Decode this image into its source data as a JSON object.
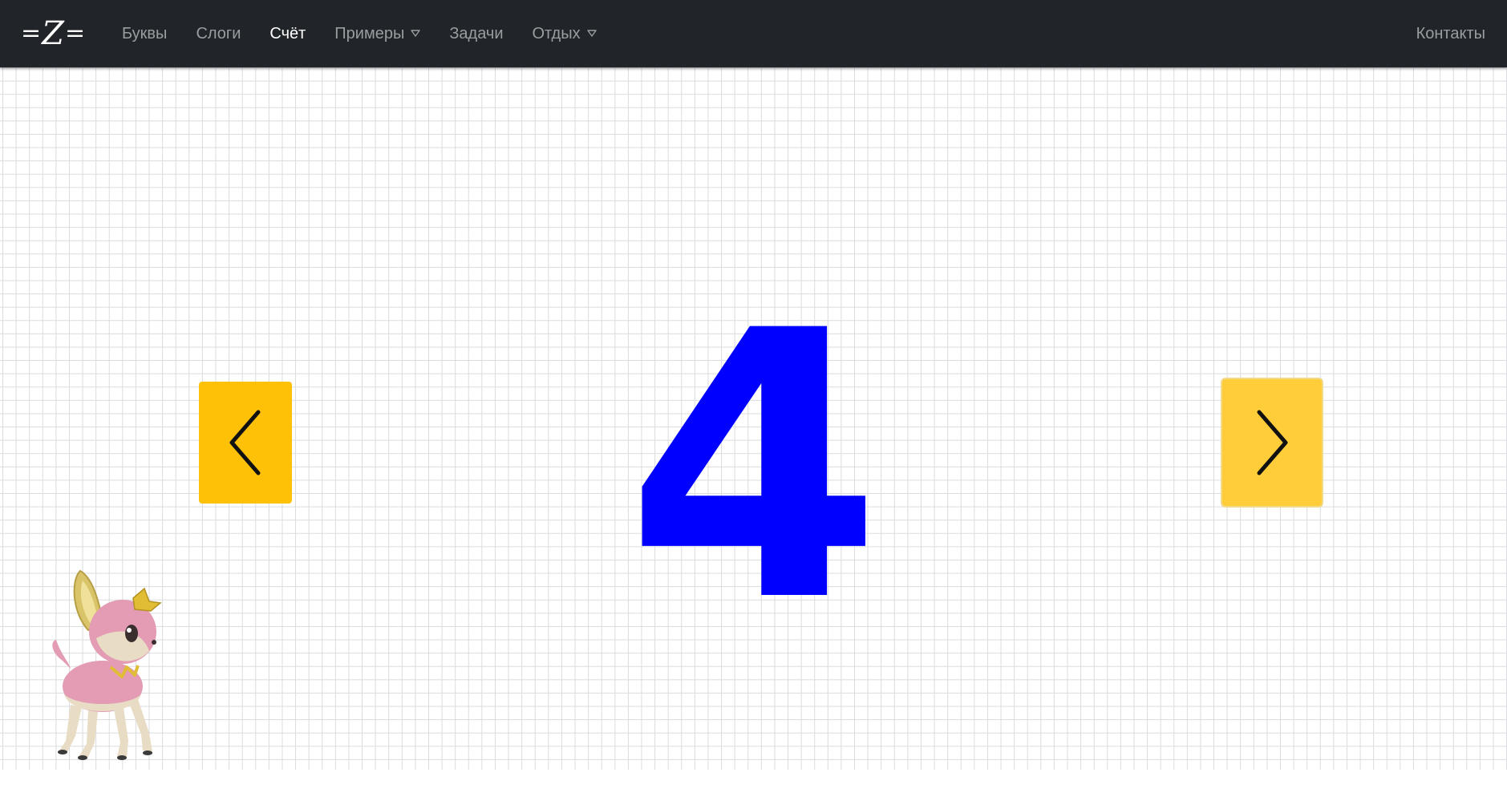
{
  "navbar": {
    "brand": "Z",
    "items": [
      {
        "label": "Буквы",
        "active": false,
        "dropdown": false
      },
      {
        "label": "Слоги",
        "active": false,
        "dropdown": false
      },
      {
        "label": "Счёт",
        "active": true,
        "dropdown": false
      },
      {
        "label": "Примеры",
        "active": false,
        "dropdown": true
      },
      {
        "label": "Задачи",
        "active": false,
        "dropdown": false
      },
      {
        "label": "Отдых",
        "active": false,
        "dropdown": true
      }
    ],
    "contacts": "Контакты"
  },
  "counter": {
    "current_number": "4",
    "prev_icon": "chevron-left-icon",
    "next_icon": "chevron-right-icon"
  },
  "colors": {
    "navbar_bg": "#212529",
    "button_bg": "#ffc107",
    "number_color": "#0000ff",
    "grid_line": "#d9dbde"
  },
  "mascot": {
    "icon": "fawn-mascot"
  }
}
